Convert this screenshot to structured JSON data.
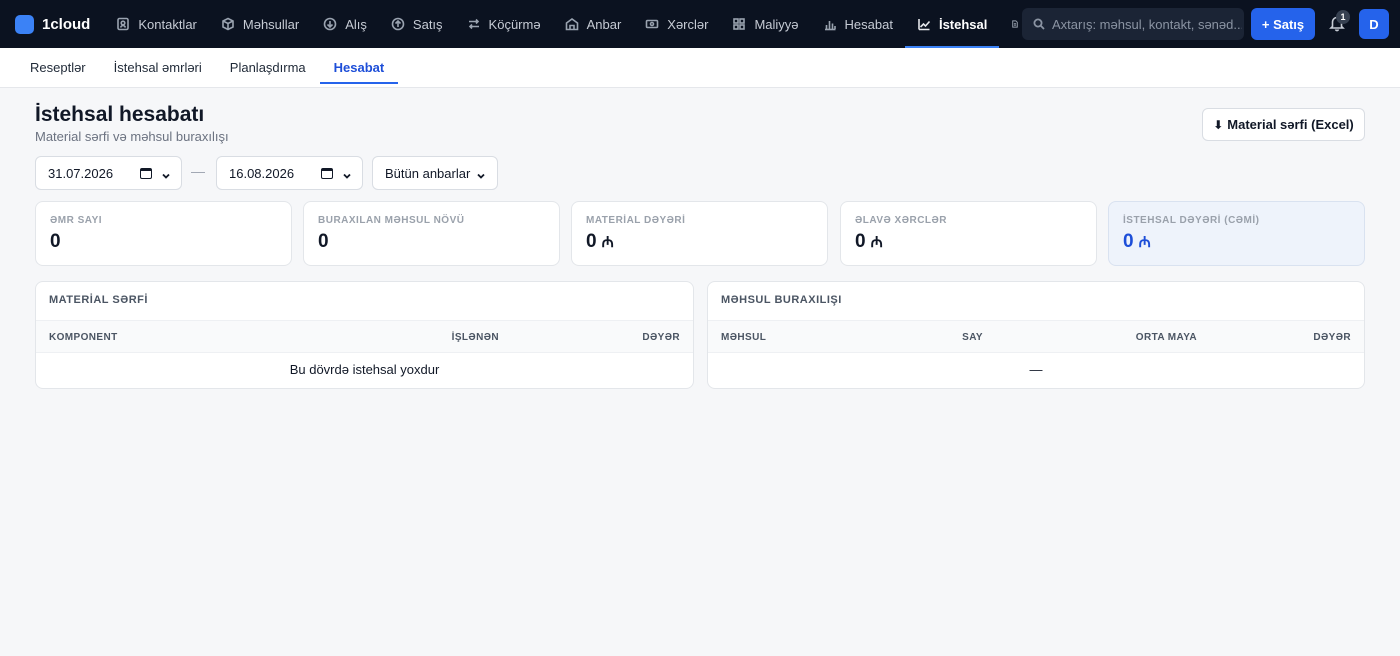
{
  "brand": {
    "name": "1cloud"
  },
  "nav": {
    "items": [
      {
        "label": "Kontaktlar",
        "icon": "contacts-icon"
      },
      {
        "label": "Məhsullar",
        "icon": "box-icon"
      },
      {
        "label": "Alış",
        "icon": "circle-down-icon"
      },
      {
        "label": "Satış",
        "icon": "circle-up-icon"
      },
      {
        "label": "Köçürmə",
        "icon": "transfer-icon"
      },
      {
        "label": "Anbar",
        "icon": "warehouse-icon"
      },
      {
        "label": "Xərclər",
        "icon": "cash-icon"
      },
      {
        "label": "Maliyyə",
        "icon": "grid-icon"
      },
      {
        "label": "Hesabat",
        "icon": "bar-chart-icon"
      },
      {
        "label": "İstehsal",
        "icon": "production-chart-icon",
        "active": true
      }
    ]
  },
  "search": {
    "placeholder": "Axtarış: məhsul, kontakt, sənəd..."
  },
  "header_actions": {
    "new_sale": "+ Satış",
    "notification_count": "1",
    "avatar_initial": "D"
  },
  "subnav": {
    "items": [
      {
        "label": "Reseptlər"
      },
      {
        "label": "İstehsal əmrləri"
      },
      {
        "label": "Planlaşdırma"
      },
      {
        "label": "Hesabat",
        "active": true
      }
    ]
  },
  "page": {
    "title": "İstehsal hesabatı",
    "subtitle": "Material sərfi və məhsul buraxılışı",
    "export_label": "Material sərfi (Excel)"
  },
  "filters": {
    "date_from": "31.07.2026",
    "date_to": "16.08.2026",
    "separator": "—",
    "warehouse": "Bütün anbarlar"
  },
  "kpis": [
    {
      "label": "ƏMR SAYI",
      "value": "0",
      "currency": ""
    },
    {
      "label": "BURAXILAN MƏHSUL NÖVÜ",
      "value": "0",
      "currency": ""
    },
    {
      "label": "MATERİAL DƏYƏRİ",
      "value": "0",
      "currency": "₼"
    },
    {
      "label": "ƏLAVƏ XƏRCLƏR",
      "value": "0",
      "currency": "₼"
    },
    {
      "label": "İSTEHSAL DƏYƏRİ (CƏMİ)",
      "value": "0",
      "currency": "₼"
    }
  ],
  "material_panel": {
    "title": "MATERİAL SƏRFİ",
    "columns": [
      "KOMPONENT",
      "İŞLƏNƏN",
      "DƏYƏR"
    ],
    "empty": "Bu dövrdə istehsal yoxdur"
  },
  "output_panel": {
    "title": "MƏHSUL BURAXILIŞI",
    "columns": [
      "MƏHSUL",
      "SAY",
      "ORTA MAYA",
      "DƏYƏR"
    ],
    "empty": "—"
  },
  "colors": {
    "topbar": "#0b1220",
    "accent": "#2563eb",
    "highlight_card": "#eef3fb"
  }
}
